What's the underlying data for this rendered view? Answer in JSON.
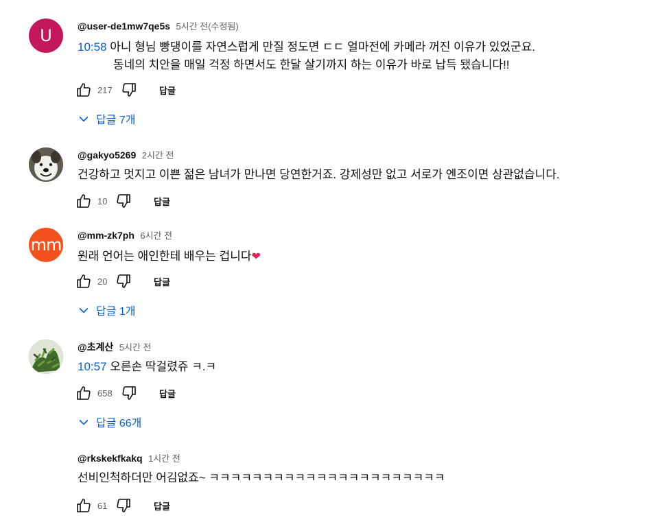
{
  "comments": [
    {
      "avatar_letter": "U",
      "avatar_color": "#c2185b",
      "author": "@user-de1mw7qe5s",
      "time": "5시간 전(수정됨)",
      "timestamp_link": "10:58",
      "text_line1": " 아니 형님 빵댕이를 자연스럽게 만질 정도면 ㄷㄷ 얼마전에 카메라 꺼진 이유가 있었군요.",
      "text_line2": "동네의 치안을 매일 걱정 하면서도 한달 살기까지 하는 이유가 바로 납득 됐습니다!!",
      "likes": "217",
      "reply_label": "답글",
      "replies_label": "답글 7개"
    },
    {
      "avatar_icon": "dog-photo-avatar",
      "author": "@gakyo5269",
      "time": "2시간 전",
      "text": "건강하고 멋지고 이쁜 젊은 남녀가 만나면 당연한거죠. 강제성만 없고 서로가 엔조이면 상관없습니다.",
      "likes": "10",
      "reply_label": "답글"
    },
    {
      "avatar_letter": "mm",
      "avatar_color": "#f4511e",
      "author": "@mm-zk7ph",
      "time": "6시간 전",
      "text": "원래 언어는 애인한테 배우는 겁니다",
      "heart": "❤",
      "likes": "20",
      "reply_label": "답글",
      "replies_label": "답글 1개"
    },
    {
      "avatar_icon": "plant-photo-avatar",
      "author": "@초계산",
      "time": "5시간 전",
      "timestamp_link": "10:57",
      "text": " 오른손 딱걸렸쥬 ㅋ.ㅋ",
      "likes": "658",
      "reply_label": "답글",
      "replies_label": "답글 66개"
    },
    {
      "author": "@rkskekfkakq",
      "time": "1시간 전",
      "text": "선비인척하더만 어김없죠~ ㅋㅋㅋㅋㅋㅋㅋㅋㅋㅋㅋㅋㅋㅋㅋㅋㅋㅋㅋㅋㅋㅋ",
      "likes": "61",
      "reply_label": "답글"
    }
  ],
  "colors": {
    "link": "#065fd4",
    "secondary_text": "#606060",
    "heart": "#e0245e"
  }
}
